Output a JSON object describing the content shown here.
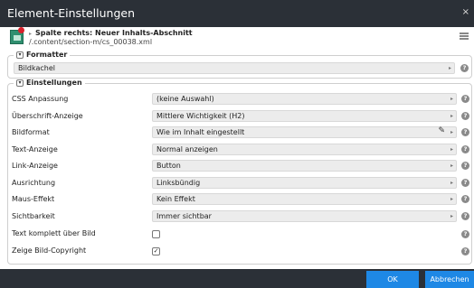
{
  "dialog": {
    "title": "Element-Einstellungen",
    "close_glyph": "×"
  },
  "resource": {
    "title": "Spalte rechts: Neuer Inhalts-Abschnitt",
    "path": "/.content/section-m/cs_00038.xml",
    "icon": "section-icon",
    "menu_icon": "hamburger-menu-icon"
  },
  "formatter": {
    "legend": "Formatter",
    "toggle_glyph": "▾",
    "value": "Bildkachel"
  },
  "settings": {
    "legend": "Einstellungen",
    "toggle_glyph": "▾",
    "rows": [
      {
        "label": "CSS Anpassung",
        "value": "(keine Auswahl)"
      },
      {
        "label": "Überschrift-Anzeige",
        "value": "Mittlere Wichtigkeit (H2)"
      },
      {
        "label": "Bildformat",
        "value": "Wie im Inhalt eingestellt",
        "editable": true
      },
      {
        "label": "Text-Anzeige",
        "value": "Normal anzeigen"
      },
      {
        "label": "Link-Anzeige",
        "value": "Button"
      },
      {
        "label": "Ausrichtung",
        "value": "Linksbündig"
      },
      {
        "label": "Maus-Effekt",
        "value": "Kein Effekt"
      },
      {
        "label": "Sichtbarkeit",
        "value": "Immer sichtbar"
      }
    ],
    "checkboxes": [
      {
        "label": "Text komplett über Bild",
        "checked": false,
        "glyph": ""
      },
      {
        "label": "Zeige Bild-Copyright",
        "checked": true,
        "glyph": "✓"
      }
    ]
  },
  "glyphs": {
    "arrow": "▸",
    "help": "?",
    "pencil": "✎"
  },
  "footer": {
    "ok_label": "OK",
    "cancel_label": "Abbrechen"
  },
  "colors": {
    "titlebar": "#2b3037",
    "accent": "#1e88e5",
    "field_bg": "#ececec"
  }
}
